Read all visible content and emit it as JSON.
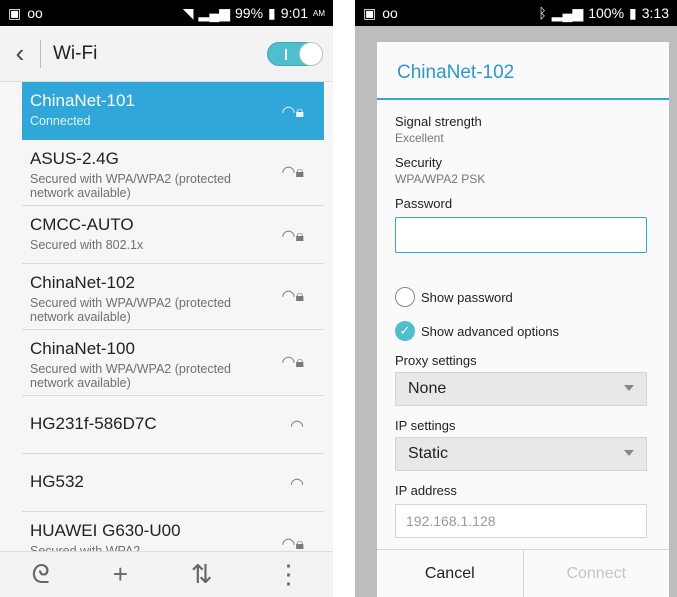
{
  "left": {
    "status": {
      "battery": "99%",
      "time": "9:01",
      "ampm": "AM"
    },
    "title": "Wi-Fi",
    "networks": [
      {
        "name": "ChinaNet-101",
        "sub": "Connected"
      },
      {
        "name": "ASUS-2.4G",
        "sub": "Secured with WPA/WPA2 (protected network available)"
      },
      {
        "name": "CMCC-AUTO",
        "sub": "Secured with 802.1x"
      },
      {
        "name": "ChinaNet-102",
        "sub": "Secured with WPA/WPA2 (protected network available)"
      },
      {
        "name": "ChinaNet-100",
        "sub": "Secured with WPA/WPA2 (protected network available)"
      },
      {
        "name": "HG231f-586D7C",
        "sub": ""
      },
      {
        "name": "HG532",
        "sub": ""
      },
      {
        "name": "HUAWEI G630-U00",
        "sub": "Secured with WPA2"
      }
    ]
  },
  "right": {
    "status": {
      "battery": "100%",
      "time": "3:13"
    },
    "dialog": {
      "title": "ChinaNet-102",
      "signal_label": "Signal strength",
      "signal_value": "Excellent",
      "security_label": "Security",
      "security_value": "WPA/WPA2 PSK",
      "password_label": "Password",
      "password_value": "",
      "show_password": "Show password",
      "show_advanced": "Show advanced options",
      "proxy_label": "Proxy settings",
      "proxy_value": "None",
      "ip_settings_label": "IP settings",
      "ip_settings_value": "Static",
      "ip_address_label": "IP address",
      "ip_address_placeholder": "192.168.1.128",
      "cancel": "Cancel",
      "connect": "Connect"
    }
  }
}
